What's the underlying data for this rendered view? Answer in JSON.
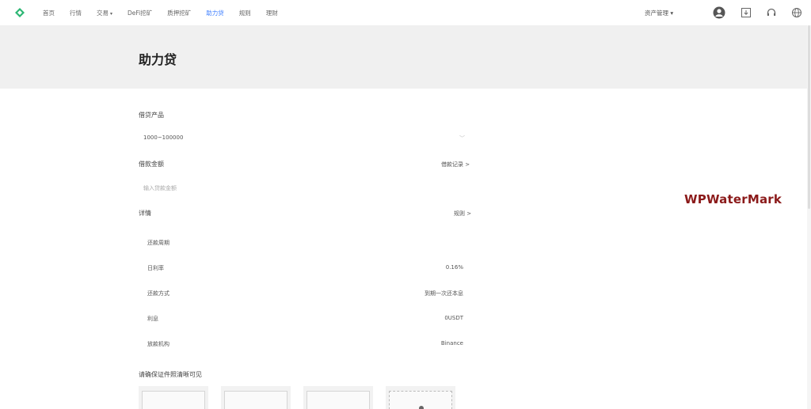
{
  "nav": {
    "items": [
      {
        "label": "首页",
        "active": false,
        "caret": false
      },
      {
        "label": "行情",
        "active": false,
        "caret": false
      },
      {
        "label": "交易",
        "active": false,
        "caret": true
      },
      {
        "label": "DeFi挖矿",
        "active": false,
        "caret": false
      },
      {
        "label": "质押挖矿",
        "active": false,
        "caret": false
      },
      {
        "label": "助力贷",
        "active": true,
        "caret": false
      },
      {
        "label": "规则",
        "active": false,
        "caret": false
      },
      {
        "label": "理财",
        "active": false,
        "caret": false
      }
    ],
    "asset_menu": "资产管理 ▾",
    "accent": "#3d7eff"
  },
  "page": {
    "title": "助力贷"
  },
  "form": {
    "product_label": "借贷产品",
    "product_value": "1000~100000",
    "amount_label": "借款金额",
    "amount_placeholder": "输入贷款金额",
    "loan_record_link": "借款记录 >",
    "details_label": "详情",
    "rules_link": "规则 >",
    "details": [
      {
        "key": "还款周期",
        "value": ""
      },
      {
        "key": "日利率",
        "value": "0.16%"
      },
      {
        "key": "还款方式",
        "value": "到期一次还本息"
      },
      {
        "key": "利息",
        "value": "0USDT"
      },
      {
        "key": "放款机构",
        "value": "Binance"
      }
    ],
    "id_photo_label": "请确保证件照清晰可见"
  },
  "watermark": "WPWaterMark"
}
